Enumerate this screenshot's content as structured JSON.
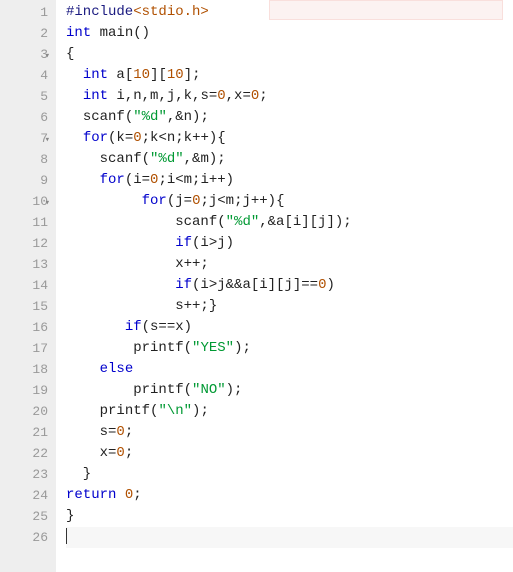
{
  "lines": [
    {
      "n": "1",
      "fold": "",
      "tokens": [
        [
          "tok-pp",
          "#include"
        ],
        [
          "tok-include",
          "<stdio.h>"
        ]
      ]
    },
    {
      "n": "2",
      "fold": "",
      "tokens": [
        [
          "tok-type",
          "int"
        ],
        [
          "tok-punct",
          " "
        ],
        [
          "tok-fn",
          "main"
        ],
        [
          "tok-punct",
          "()"
        ]
      ]
    },
    {
      "n": "3",
      "fold": "▾",
      "tokens": [
        [
          "tok-punct",
          "{"
        ]
      ]
    },
    {
      "n": "4",
      "fold": "",
      "tokens": [
        [
          "tok-punct",
          "  "
        ],
        [
          "tok-type",
          "int"
        ],
        [
          "tok-punct",
          " a["
        ],
        [
          "tok-num",
          "10"
        ],
        [
          "tok-punct",
          "]["
        ],
        [
          "tok-num",
          "10"
        ],
        [
          "tok-punct",
          "];"
        ]
      ]
    },
    {
      "n": "5",
      "fold": "",
      "tokens": [
        [
          "tok-punct",
          "  "
        ],
        [
          "tok-type",
          "int"
        ],
        [
          "tok-punct",
          " i,n,m,j,k,s="
        ],
        [
          "tok-num",
          "0"
        ],
        [
          "tok-punct",
          ",x="
        ],
        [
          "tok-num",
          "0"
        ],
        [
          "tok-punct",
          ";"
        ]
      ]
    },
    {
      "n": "6",
      "fold": "",
      "tokens": [
        [
          "tok-punct",
          "  "
        ],
        [
          "tok-fn",
          "scanf"
        ],
        [
          "tok-punct",
          "("
        ],
        [
          "tok-str",
          "\"%d\""
        ],
        [
          "tok-punct",
          ",&n);"
        ]
      ]
    },
    {
      "n": "7",
      "fold": "▾",
      "tokens": [
        [
          "tok-punct",
          "  "
        ],
        [
          "tok-kw",
          "for"
        ],
        [
          "tok-punct",
          "(k="
        ],
        [
          "tok-num",
          "0"
        ],
        [
          "tok-punct",
          ";k<n;k++){"
        ]
      ]
    },
    {
      "n": "8",
      "fold": "",
      "tokens": [
        [
          "tok-punct",
          "    "
        ],
        [
          "tok-fn",
          "scanf"
        ],
        [
          "tok-punct",
          "("
        ],
        [
          "tok-str",
          "\"%d\""
        ],
        [
          "tok-punct",
          ",&m);"
        ]
      ]
    },
    {
      "n": "9",
      "fold": "",
      "tokens": [
        [
          "tok-punct",
          "    "
        ],
        [
          "tok-kw",
          "for"
        ],
        [
          "tok-punct",
          "(i="
        ],
        [
          "tok-num",
          "0"
        ],
        [
          "tok-punct",
          ";i<m;i++)"
        ]
      ]
    },
    {
      "n": "10",
      "fold": "▾",
      "tokens": [
        [
          "tok-punct",
          "         "
        ],
        [
          "tok-kw",
          "for"
        ],
        [
          "tok-punct",
          "(j="
        ],
        [
          "tok-num",
          "0"
        ],
        [
          "tok-punct",
          ";j<m;j++){"
        ]
      ]
    },
    {
      "n": "11",
      "fold": "",
      "tokens": [
        [
          "tok-punct",
          "             "
        ],
        [
          "tok-fn",
          "scanf"
        ],
        [
          "tok-punct",
          "("
        ],
        [
          "tok-str",
          "\"%d\""
        ],
        [
          "tok-punct",
          ",&a[i][j]);"
        ]
      ]
    },
    {
      "n": "12",
      "fold": "",
      "tokens": [
        [
          "tok-punct",
          "             "
        ],
        [
          "tok-kw",
          "if"
        ],
        [
          "tok-punct",
          "(i>j)"
        ]
      ]
    },
    {
      "n": "13",
      "fold": "",
      "tokens": [
        [
          "tok-punct",
          "             x++;"
        ]
      ]
    },
    {
      "n": "14",
      "fold": "",
      "tokens": [
        [
          "tok-punct",
          "             "
        ],
        [
          "tok-kw",
          "if"
        ],
        [
          "tok-punct",
          "(i>j&&a[i][j]=="
        ],
        [
          "tok-num",
          "0"
        ],
        [
          "tok-punct",
          ")"
        ]
      ]
    },
    {
      "n": "15",
      "fold": "",
      "tokens": [
        [
          "tok-punct",
          "             s++;}"
        ]
      ]
    },
    {
      "n": "16",
      "fold": "",
      "tokens": [
        [
          "tok-punct",
          "       "
        ],
        [
          "tok-kw",
          "if"
        ],
        [
          "tok-punct",
          "(s==x)"
        ]
      ]
    },
    {
      "n": "17",
      "fold": "",
      "tokens": [
        [
          "tok-punct",
          "        "
        ],
        [
          "tok-fn",
          "printf"
        ],
        [
          "tok-punct",
          "("
        ],
        [
          "tok-str",
          "\"YES\""
        ],
        [
          "tok-punct",
          ");"
        ]
      ]
    },
    {
      "n": "18",
      "fold": "",
      "tokens": [
        [
          "tok-punct",
          "    "
        ],
        [
          "tok-kw",
          "else"
        ]
      ]
    },
    {
      "n": "19",
      "fold": "",
      "tokens": [
        [
          "tok-punct",
          "        "
        ],
        [
          "tok-fn",
          "printf"
        ],
        [
          "tok-punct",
          "("
        ],
        [
          "tok-str",
          "\"NO\""
        ],
        [
          "tok-punct",
          ");"
        ]
      ]
    },
    {
      "n": "20",
      "fold": "",
      "tokens": [
        [
          "tok-punct",
          "    "
        ],
        [
          "tok-fn",
          "printf"
        ],
        [
          "tok-punct",
          "("
        ],
        [
          "tok-str",
          "\"\\n\""
        ],
        [
          "tok-punct",
          ");"
        ]
      ]
    },
    {
      "n": "21",
      "fold": "",
      "tokens": [
        [
          "tok-punct",
          "    s="
        ],
        [
          "tok-num",
          "0"
        ],
        [
          "tok-punct",
          ";"
        ]
      ]
    },
    {
      "n": "22",
      "fold": "",
      "tokens": [
        [
          "tok-punct",
          "    x="
        ],
        [
          "tok-num",
          "0"
        ],
        [
          "tok-punct",
          ";"
        ]
      ]
    },
    {
      "n": "23",
      "fold": "",
      "tokens": [
        [
          "tok-punct",
          "  }"
        ]
      ]
    },
    {
      "n": "24",
      "fold": "",
      "tokens": [
        [
          "tok-kw",
          "return"
        ],
        [
          "tok-punct",
          " "
        ],
        [
          "tok-num",
          "0"
        ],
        [
          "tok-punct",
          ";"
        ]
      ]
    },
    {
      "n": "25",
      "fold": "",
      "tokens": [
        [
          "tok-punct",
          "}"
        ]
      ]
    },
    {
      "n": "26",
      "fold": "",
      "tokens": [],
      "active": true
    }
  ]
}
